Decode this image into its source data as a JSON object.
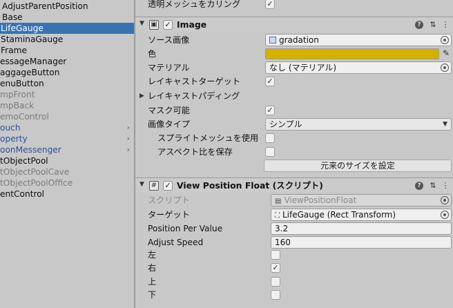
{
  "hierarchy": {
    "items": [
      {
        "label": "AdjustParentPosition",
        "style": "normal",
        "chevron": false,
        "indent": 3
      },
      {
        "label": "Base",
        "style": "normal",
        "chevron": false,
        "indent": 3
      },
      {
        "label": "LifeGauge",
        "style": "selected",
        "chevron": false,
        "indent": 1
      },
      {
        "label": "StaminaGauge",
        "style": "normal",
        "chevron": false,
        "indent": 1
      },
      {
        "label": "Frame",
        "style": "normal",
        "chevron": false,
        "indent": 1
      },
      {
        "label": "essageManager",
        "style": "normal",
        "chevron": false,
        "indent": 0
      },
      {
        "label": "aggageButton",
        "style": "normal",
        "chevron": false,
        "indent": 0
      },
      {
        "label": "enuButton",
        "style": "normal",
        "chevron": false,
        "indent": 0
      },
      {
        "label": "mpFront",
        "style": "dim",
        "chevron": false,
        "indent": 0
      },
      {
        "label": "mpBack",
        "style": "dim",
        "chevron": false,
        "indent": 0
      },
      {
        "label": "emoControl",
        "style": "dim",
        "chevron": false,
        "indent": 0
      },
      {
        "label": "ouch",
        "style": "prefab",
        "chevron": true,
        "indent": 0
      },
      {
        "label": "operty",
        "style": "prefab",
        "chevron": true,
        "indent": 0
      },
      {
        "label": "oonMessenger",
        "style": "prefab",
        "chevron": true,
        "indent": 0
      },
      {
        "label": "tObjectPool",
        "style": "normal",
        "chevron": false,
        "indent": 0
      },
      {
        "label": "tObjectPoolCave",
        "style": "dim",
        "chevron": false,
        "indent": 0
      },
      {
        "label": "tObjectPoolOffice",
        "style": "dim",
        "chevron": false,
        "indent": 0
      },
      {
        "label": "entControl",
        "style": "normal",
        "chevron": false,
        "indent": 0
      }
    ]
  },
  "inspector": {
    "top_row": {
      "label": "透明メッシュをカリング",
      "checked": "✓"
    },
    "image": {
      "title": "Image",
      "source_label": "ソース画像",
      "source_value": "gradation",
      "color_label": "色",
      "color_value": "#d4b000",
      "material_label": "マテリアル",
      "material_value": "なし (マテリアル)",
      "raycast_label": "レイキャストターゲット",
      "raycast_checked": "✓",
      "raycast_padding_label": "レイキャストパディング",
      "maskable_label": "マスク可能",
      "maskable_checked": "✓",
      "image_type_label": "画像タイプ",
      "image_type_value": "シンプル",
      "use_sprite_mesh_label": "スプライトメッシュを使用",
      "preserve_aspect_label": "アスペクト比を保存",
      "native_size_button": "元来のサイズを設定"
    },
    "vpf": {
      "title": "View Position Float (スクリプト)",
      "script_label": "スクリプト",
      "script_value": "ViewPositionFloat",
      "target_label": "ターゲット",
      "target_value": "LifeGauge (Rect Transform)",
      "ppv_label": "Position Per Value",
      "ppv_value": "3.2",
      "adjust_label": "Adjust Speed",
      "adjust_value": "160",
      "left_label": "左",
      "right_label": "右",
      "right_checked": "✓",
      "up_label": "上",
      "down_label": "下"
    }
  }
}
